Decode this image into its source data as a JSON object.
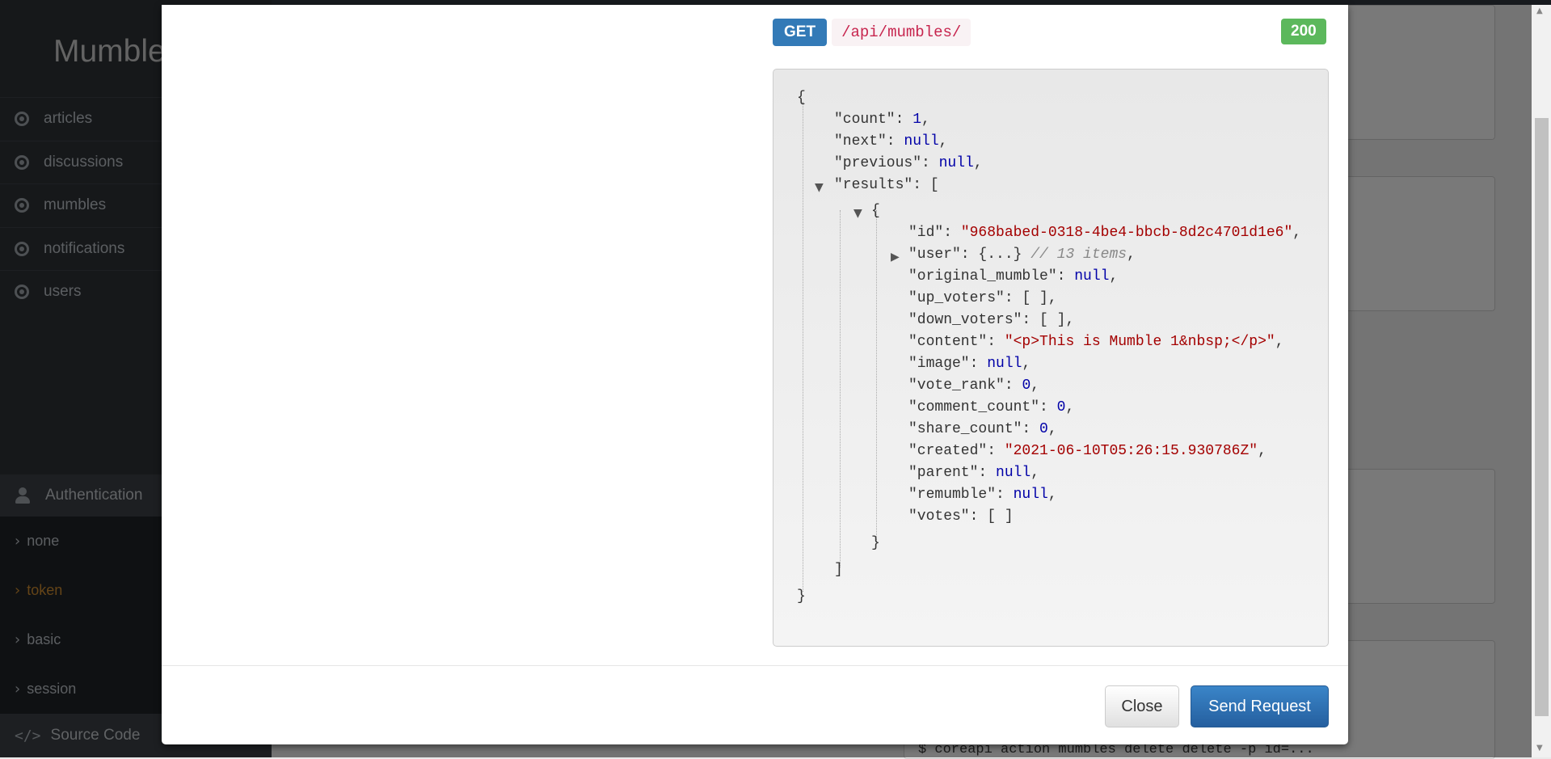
{
  "background": {
    "brand": "Mumble",
    "nav": [
      {
        "label": "articles"
      },
      {
        "label": "discussions"
      },
      {
        "label": "mumbles"
      },
      {
        "label": "notifications"
      },
      {
        "label": "users"
      }
    ],
    "auth_header": "Authentication",
    "auth_options": [
      {
        "label": "none"
      },
      {
        "label": "token"
      },
      {
        "label": "basic"
      },
      {
        "label": "session"
      }
    ],
    "source_code": "Source Code",
    "command": "$ coreapi action mumbles delete delete -p id=..."
  },
  "modal": {
    "method": "GET",
    "path": "/api/mumbles/",
    "status": "200",
    "response": {
      "count": "1",
      "next": "null",
      "previous": "null",
      "result": {
        "id": "\"968babed-0318-4be4-bbcb-8d2c4701d1e6\"",
        "user_collapsed": "{...}",
        "user_comment": "// 13 items",
        "original_mumble": "null",
        "up_voters": "[ ]",
        "down_voters": "[ ]",
        "content": "\"<p>This is Mumble 1&nbsp;</p>\"",
        "image": "null",
        "vote_rank": "0",
        "comment_count": "0",
        "share_count": "0",
        "created": "\"2021-06-10T05:26:15.930786Z\"",
        "parent": "null",
        "remumble": "null",
        "votes": "[ ]"
      }
    },
    "close_label": "Close",
    "send_label": "Send Request"
  },
  "colors": {
    "method_badge": "#337ab7",
    "status_badge": "#5cb85c",
    "send_button": "#2a6bb0",
    "active_auth": "#c9892f",
    "json_number": "#0000a8",
    "json_string": "#a40000"
  }
}
